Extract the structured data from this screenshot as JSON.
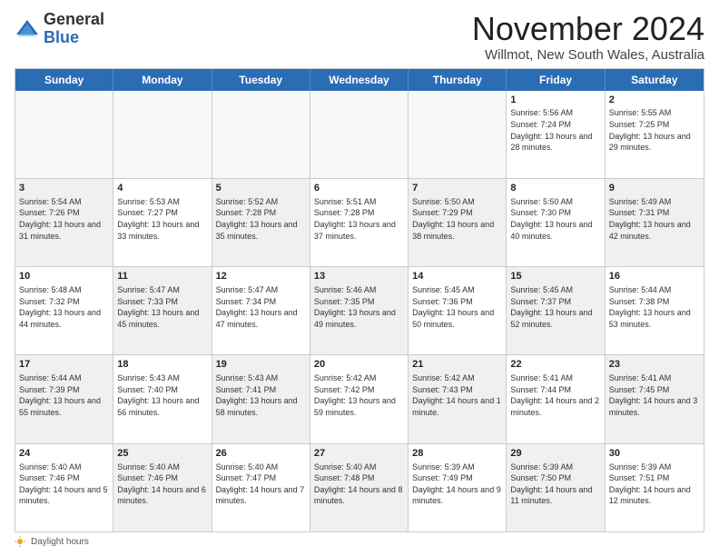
{
  "header": {
    "logo_general": "General",
    "logo_blue": "Blue",
    "main_title": "November 2024",
    "subtitle": "Willmot, New South Wales, Australia"
  },
  "weekdays": [
    "Sunday",
    "Monday",
    "Tuesday",
    "Wednesday",
    "Thursday",
    "Friday",
    "Saturday"
  ],
  "weeks": [
    [
      {
        "day": "",
        "info": "",
        "shaded": true
      },
      {
        "day": "",
        "info": "",
        "shaded": true
      },
      {
        "day": "",
        "info": "",
        "shaded": true
      },
      {
        "day": "",
        "info": "",
        "shaded": true
      },
      {
        "day": "",
        "info": "",
        "shaded": true
      },
      {
        "day": "1",
        "info": "Sunrise: 5:56 AM\nSunset: 7:24 PM\nDaylight: 13 hours and 28 minutes.",
        "shaded": false
      },
      {
        "day": "2",
        "info": "Sunrise: 5:55 AM\nSunset: 7:25 PM\nDaylight: 13 hours and 29 minutes.",
        "shaded": false
      }
    ],
    [
      {
        "day": "3",
        "info": "Sunrise: 5:54 AM\nSunset: 7:26 PM\nDaylight: 13 hours and 31 minutes.",
        "shaded": true
      },
      {
        "day": "4",
        "info": "Sunrise: 5:53 AM\nSunset: 7:27 PM\nDaylight: 13 hours and 33 minutes.",
        "shaded": false
      },
      {
        "day": "5",
        "info": "Sunrise: 5:52 AM\nSunset: 7:28 PM\nDaylight: 13 hours and 35 minutes.",
        "shaded": true
      },
      {
        "day": "6",
        "info": "Sunrise: 5:51 AM\nSunset: 7:28 PM\nDaylight: 13 hours and 37 minutes.",
        "shaded": false
      },
      {
        "day": "7",
        "info": "Sunrise: 5:50 AM\nSunset: 7:29 PM\nDaylight: 13 hours and 38 minutes.",
        "shaded": true
      },
      {
        "day": "8",
        "info": "Sunrise: 5:50 AM\nSunset: 7:30 PM\nDaylight: 13 hours and 40 minutes.",
        "shaded": false
      },
      {
        "day": "9",
        "info": "Sunrise: 5:49 AM\nSunset: 7:31 PM\nDaylight: 13 hours and 42 minutes.",
        "shaded": true
      }
    ],
    [
      {
        "day": "10",
        "info": "Sunrise: 5:48 AM\nSunset: 7:32 PM\nDaylight: 13 hours and 44 minutes.",
        "shaded": false
      },
      {
        "day": "11",
        "info": "Sunrise: 5:47 AM\nSunset: 7:33 PM\nDaylight: 13 hours and 45 minutes.",
        "shaded": true
      },
      {
        "day": "12",
        "info": "Sunrise: 5:47 AM\nSunset: 7:34 PM\nDaylight: 13 hours and 47 minutes.",
        "shaded": false
      },
      {
        "day": "13",
        "info": "Sunrise: 5:46 AM\nSunset: 7:35 PM\nDaylight: 13 hours and 49 minutes.",
        "shaded": true
      },
      {
        "day": "14",
        "info": "Sunrise: 5:45 AM\nSunset: 7:36 PM\nDaylight: 13 hours and 50 minutes.",
        "shaded": false
      },
      {
        "day": "15",
        "info": "Sunrise: 5:45 AM\nSunset: 7:37 PM\nDaylight: 13 hours and 52 minutes.",
        "shaded": true
      },
      {
        "day": "16",
        "info": "Sunrise: 5:44 AM\nSunset: 7:38 PM\nDaylight: 13 hours and 53 minutes.",
        "shaded": false
      }
    ],
    [
      {
        "day": "17",
        "info": "Sunrise: 5:44 AM\nSunset: 7:39 PM\nDaylight: 13 hours and 55 minutes.",
        "shaded": true
      },
      {
        "day": "18",
        "info": "Sunrise: 5:43 AM\nSunset: 7:40 PM\nDaylight: 13 hours and 56 minutes.",
        "shaded": false
      },
      {
        "day": "19",
        "info": "Sunrise: 5:43 AM\nSunset: 7:41 PM\nDaylight: 13 hours and 58 minutes.",
        "shaded": true
      },
      {
        "day": "20",
        "info": "Sunrise: 5:42 AM\nSunset: 7:42 PM\nDaylight: 13 hours and 59 minutes.",
        "shaded": false
      },
      {
        "day": "21",
        "info": "Sunrise: 5:42 AM\nSunset: 7:43 PM\nDaylight: 14 hours and 1 minute.",
        "shaded": true
      },
      {
        "day": "22",
        "info": "Sunrise: 5:41 AM\nSunset: 7:44 PM\nDaylight: 14 hours and 2 minutes.",
        "shaded": false
      },
      {
        "day": "23",
        "info": "Sunrise: 5:41 AM\nSunset: 7:45 PM\nDaylight: 14 hours and 3 minutes.",
        "shaded": true
      }
    ],
    [
      {
        "day": "24",
        "info": "Sunrise: 5:40 AM\nSunset: 7:46 PM\nDaylight: 14 hours and 5 minutes.",
        "shaded": false
      },
      {
        "day": "25",
        "info": "Sunrise: 5:40 AM\nSunset: 7:46 PM\nDaylight: 14 hours and 6 minutes.",
        "shaded": true
      },
      {
        "day": "26",
        "info": "Sunrise: 5:40 AM\nSunset: 7:47 PM\nDaylight: 14 hours and 7 minutes.",
        "shaded": false
      },
      {
        "day": "27",
        "info": "Sunrise: 5:40 AM\nSunset: 7:48 PM\nDaylight: 14 hours and 8 minutes.",
        "shaded": true
      },
      {
        "day": "28",
        "info": "Sunrise: 5:39 AM\nSunset: 7:49 PM\nDaylight: 14 hours and 9 minutes.",
        "shaded": false
      },
      {
        "day": "29",
        "info": "Sunrise: 5:39 AM\nSunset: 7:50 PM\nDaylight: 14 hours and 11 minutes.",
        "shaded": true
      },
      {
        "day": "30",
        "info": "Sunrise: 5:39 AM\nSunset: 7:51 PM\nDaylight: 14 hours and 12 minutes.",
        "shaded": false
      }
    ]
  ],
  "footer": {
    "daylight_label": "Daylight hours"
  }
}
